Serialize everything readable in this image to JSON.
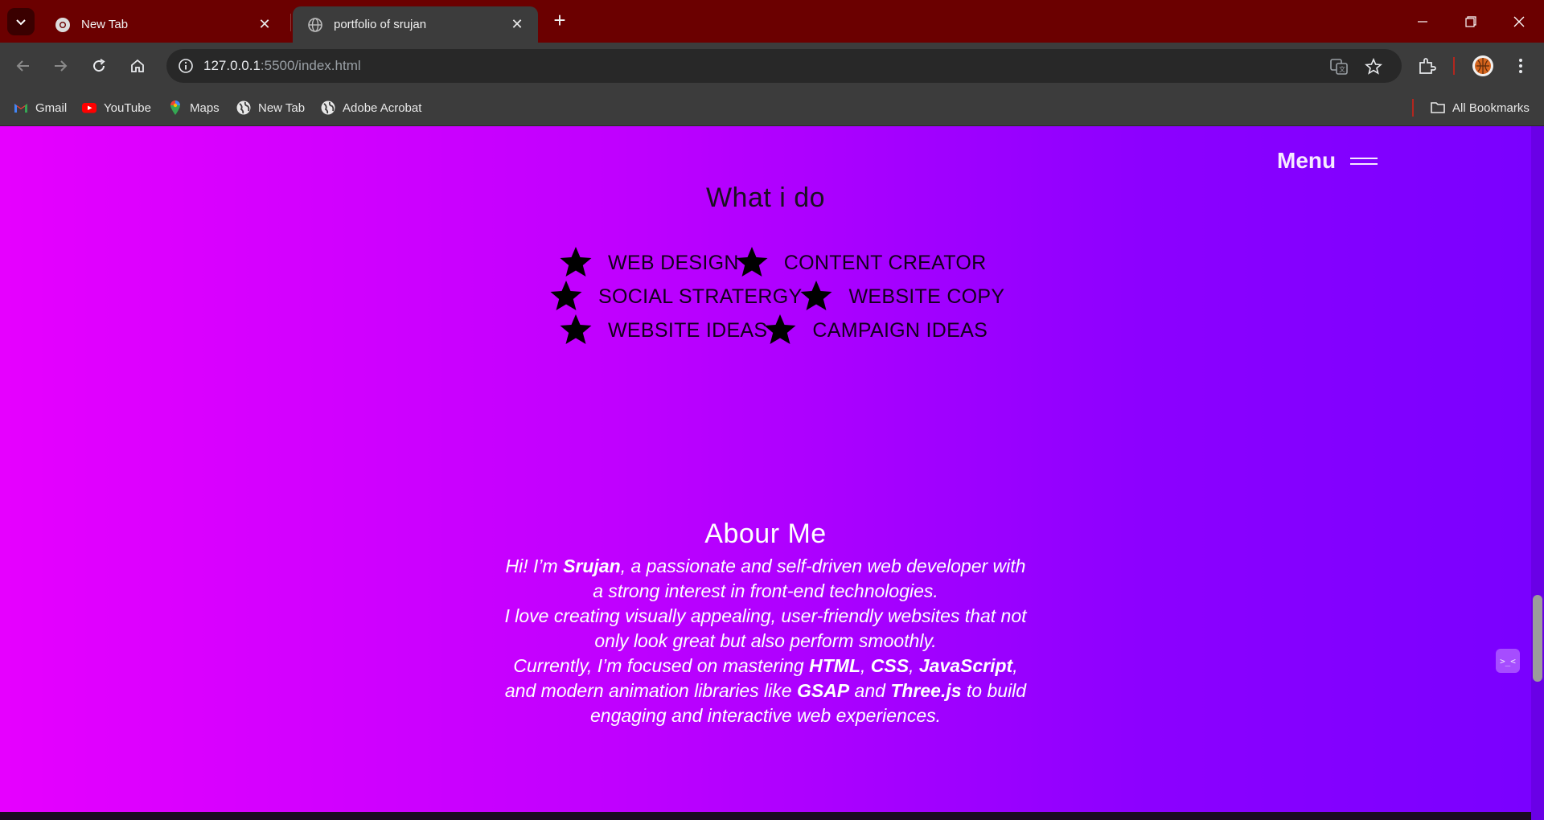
{
  "browser": {
    "tabs": [
      {
        "title": "New Tab",
        "active": false,
        "icon": "chrome-icon"
      },
      {
        "title": "portfolio of srujan",
        "active": true,
        "icon": "globe-icon"
      }
    ],
    "url_host": "127.0.0.1",
    "url_path": ":5500/index.html",
    "bookmarks": [
      {
        "label": "Gmail",
        "icon": "gmail-icon"
      },
      {
        "label": "YouTube",
        "icon": "youtube-icon"
      },
      {
        "label": "Maps",
        "icon": "maps-icon"
      },
      {
        "label": "New Tab",
        "icon": "globe-icon"
      },
      {
        "label": "Adobe Acrobat",
        "icon": "globe-icon"
      }
    ],
    "all_bookmarks_label": "All Bookmarks",
    "theme_color": "#6b0000"
  },
  "page": {
    "menu_label": "Menu",
    "what_i_do_title": "What i do",
    "skills": [
      "WEB DESIGN",
      "CONTENT CREATOR",
      "SOCIAL STRATERGY",
      "WEBSITE COPY",
      "WEBSITE IDEAS",
      "CAMPAIGN IDEAS"
    ],
    "about_title": "Abour Me",
    "about": {
      "p1_a": "Hi! I’m ",
      "name": "Srujan",
      "p1_b": ", a passionate and self-driven web developer with a strong interest in front-end technologies.",
      "p2": "I love creating visually appealing, user-friendly websites that not only look great but also perform smoothly.",
      "p3_a": "Currently, I’m focused on mastering ",
      "html": "HTML",
      "sep1": ", ",
      "css": "CSS",
      "sep2": ", ",
      "js": "JavaScript",
      "p3_b": ", and modern animation libraries like ",
      "gsap": "GSAP",
      "p3_c": " and ",
      "three": "Three.js",
      "p3_d": " to build engaging and interactive web experiences."
    },
    "widget_label": ">_<",
    "gradient_start": "#e600ff",
    "gradient_end": "#7a00ff"
  }
}
